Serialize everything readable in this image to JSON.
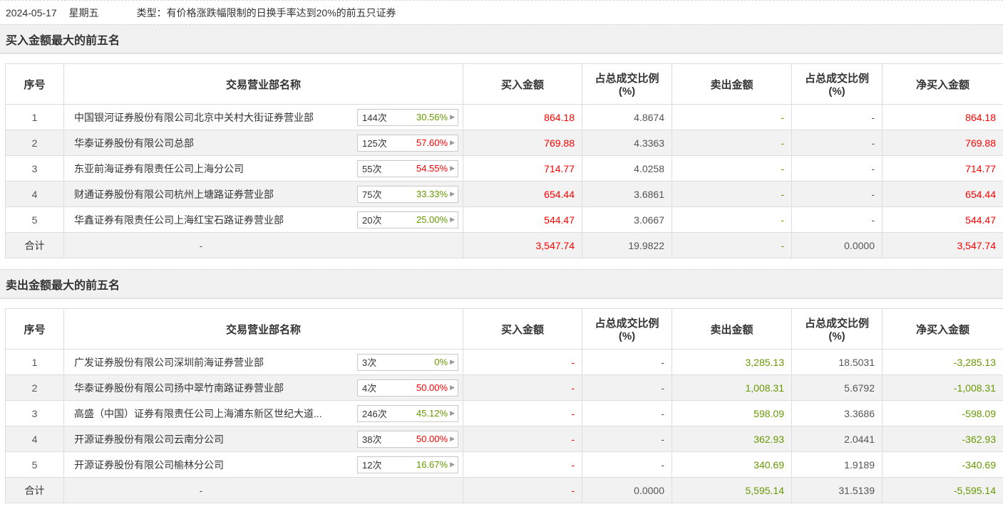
{
  "page": {
    "date": "2024-05-17",
    "weekday": "星期五",
    "type_label": "类型：有价格涨跌幅限制的日换手率达到20%的前五只证券"
  },
  "icons": {
    "expand_arrow": "▶"
  },
  "colors": {
    "red": "#ff0000",
    "green": "#669900",
    "row_stripe": "#f2f2f2",
    "band_bg": "#f1f1f1",
    "border": "#dddddd"
  },
  "tables": [
    {
      "section_title": "买入金额最大的前五名",
      "headers": [
        {
          "label": "序号",
          "sub": ""
        },
        {
          "label": "交易营业部名称",
          "sub": ""
        },
        {
          "label": "买入金额",
          "sub": ""
        },
        {
          "label": "占总成交比例",
          "sub": "(%)"
        },
        {
          "label": "卖出金额",
          "sub": ""
        },
        {
          "label": "占总成交比例",
          "sub": "(%)"
        },
        {
          "label": "净买入金额",
          "sub": ""
        }
      ],
      "rows": [
        {
          "seq": "1",
          "name": "中国银河证券股份有限公司北京中关村大街证券营业部",
          "count": "144次",
          "pct": "30.56%",
          "pct_color": "green",
          "buy": "864.18",
          "buy_pct": "4.8674",
          "sell": "-",
          "sell_pct": "-",
          "net": "864.18",
          "net_color": "red"
        },
        {
          "seq": "2",
          "name": "华泰证券股份有限公司总部",
          "count": "125次",
          "pct": "57.60%",
          "pct_color": "red",
          "buy": "769.88",
          "buy_pct": "4.3363",
          "sell": "-",
          "sell_pct": "-",
          "net": "769.88",
          "net_color": "red"
        },
        {
          "seq": "3",
          "name": "东亚前海证券有限责任公司上海分公司",
          "count": "55次",
          "pct": "54.55%",
          "pct_color": "red",
          "buy": "714.77",
          "buy_pct": "4.0258",
          "sell": "-",
          "sell_pct": "-",
          "net": "714.77",
          "net_color": "red"
        },
        {
          "seq": "4",
          "name": "财通证券股份有限公司杭州上塘路证券营业部",
          "count": "75次",
          "pct": "33.33%",
          "pct_color": "green",
          "buy": "654.44",
          "buy_pct": "3.6861",
          "sell": "-",
          "sell_pct": "-",
          "net": "654.44",
          "net_color": "red"
        },
        {
          "seq": "5",
          "name": "华鑫证券有限责任公司上海红宝石路证券营业部",
          "count": "20次",
          "pct": "25.00%",
          "pct_color": "green",
          "buy": "544.47",
          "buy_pct": "3.0667",
          "sell": "-",
          "sell_pct": "-",
          "net": "544.47",
          "net_color": "red"
        }
      ],
      "total": {
        "seq": "合计",
        "name": "-",
        "buy": "3,547.74",
        "buy_pct": "19.9822",
        "sell": "-",
        "sell_pct": "0.0000",
        "net": "3,547.74",
        "net_color": "red"
      }
    },
    {
      "section_title": "卖出金额最大的前五名",
      "headers": [
        {
          "label": "序号",
          "sub": ""
        },
        {
          "label": "交易营业部名称",
          "sub": ""
        },
        {
          "label": "买入金额",
          "sub": ""
        },
        {
          "label": "占总成交比例",
          "sub": "(%)"
        },
        {
          "label": "卖出金额",
          "sub": ""
        },
        {
          "label": "占总成交比例",
          "sub": "(%)"
        },
        {
          "label": "净买入金额",
          "sub": ""
        }
      ],
      "rows": [
        {
          "seq": "1",
          "name": "广发证券股份有限公司深圳前海证券营业部",
          "count": "3次",
          "pct": "0%",
          "pct_color": "green",
          "buy": "-",
          "buy_pct": "-",
          "sell": "3,285.13",
          "sell_pct": "18.5031",
          "net": "-3,285.13",
          "net_color": "green"
        },
        {
          "seq": "2",
          "name": "华泰证券股份有限公司扬中翠竹南路证券营业部",
          "count": "4次",
          "pct": "50.00%",
          "pct_color": "red",
          "buy": "-",
          "buy_pct": "-",
          "sell": "1,008.31",
          "sell_pct": "5.6792",
          "net": "-1,008.31",
          "net_color": "green"
        },
        {
          "seq": "3",
          "name": "高盛（中国）证券有限责任公司上海浦东新区世纪大道...",
          "count": "246次",
          "pct": "45.12%",
          "pct_color": "green",
          "buy": "-",
          "buy_pct": "-",
          "sell": "598.09",
          "sell_pct": "3.3686",
          "net": "-598.09",
          "net_color": "green"
        },
        {
          "seq": "4",
          "name": "开源证券股份有限公司云南分公司",
          "count": "38次",
          "pct": "50.00%",
          "pct_color": "red",
          "buy": "-",
          "buy_pct": "-",
          "sell": "362.93",
          "sell_pct": "2.0441",
          "net": "-362.93",
          "net_color": "green"
        },
        {
          "seq": "5",
          "name": "开源证券股份有限公司榆林分公司",
          "count": "12次",
          "pct": "16.67%",
          "pct_color": "green",
          "buy": "-",
          "buy_pct": "-",
          "sell": "340.69",
          "sell_pct": "1.9189",
          "net": "-340.69",
          "net_color": "green"
        }
      ],
      "total": {
        "seq": "合计",
        "name": "-",
        "buy": "-",
        "buy_pct": "0.0000",
        "sell": "5,595.14",
        "sell_pct": "31.5139",
        "net": "-5,595.14",
        "net_color": "green"
      }
    }
  ]
}
